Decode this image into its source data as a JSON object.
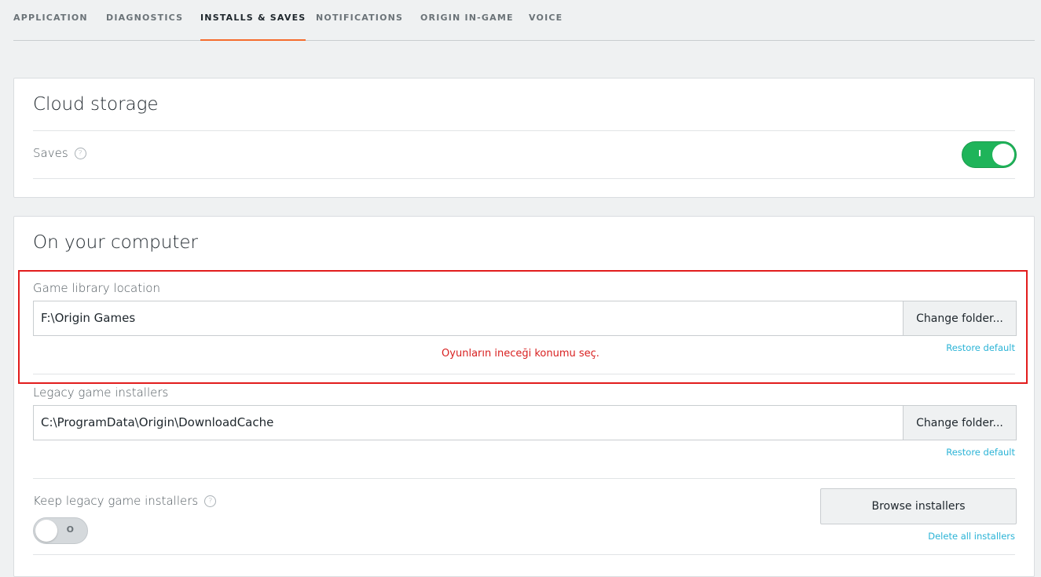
{
  "tabs": [
    {
      "label": "APPLICATION"
    },
    {
      "label": "DIAGNOSTICS"
    },
    {
      "label": "INSTALLS & SAVES"
    },
    {
      "label": "NOTIFICATIONS"
    },
    {
      "label": "ORIGIN IN-GAME"
    },
    {
      "label": "VOICE"
    }
  ],
  "active_tab": "INSTALLS & SAVES",
  "cloud_storage": {
    "title": "Cloud storage",
    "saves_label": "Saves",
    "saves_toggle": {
      "state": "on",
      "mark": "I"
    }
  },
  "computer": {
    "title": "On your computer",
    "game_library": {
      "label": "Game library location",
      "value": "F:\\Origin Games",
      "button": "Change folder...",
      "restore": "Restore default"
    },
    "annotation": "Oyunların ineceği konumu seç.",
    "legacy_installers": {
      "label": "Legacy game installers",
      "value": "C:\\ProgramData\\Origin\\DownloadCache",
      "button": "Change folder...",
      "restore": "Restore default"
    },
    "keep_legacy": {
      "label": "Keep legacy game installers",
      "toggle": {
        "state": "off",
        "mark": "O"
      },
      "browse_button": "Browse installers",
      "delete_link": "Delete all installers"
    }
  },
  "help_glyph": "?",
  "colors": {
    "accent_tab": "#f56c2d",
    "toggle_on": "#1fb45a",
    "link": "#2ab3d6",
    "annotation": "#e21c1c"
  }
}
